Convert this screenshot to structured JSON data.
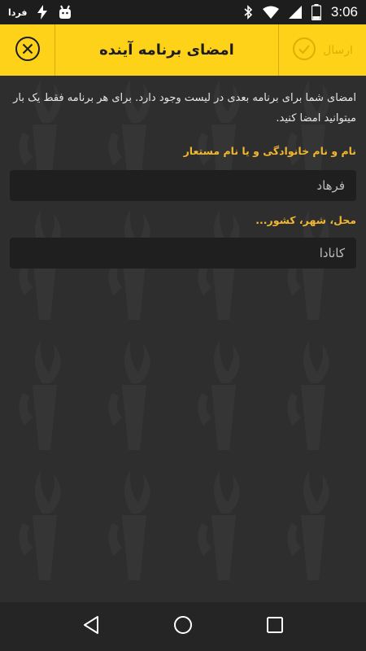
{
  "status_bar": {
    "time": "3:06",
    "app_logo_text": "فردا",
    "battery_level": "5"
  },
  "header": {
    "title": "امضای برنامه آینده",
    "send_label": "ارسال",
    "accent_color": "#ffd21a"
  },
  "form": {
    "intro": "امضای شما برای برنامه بعدی در لیست وجود دارد. برای هر برنامه فقط یک بار میتوانید امضا کنید.",
    "name_label": "نام و نام خانوادگی و یا نام مستعار",
    "name_value": "فرهاد",
    "place_label": "محل، شهر، کشور...",
    "place_value": "کانادا"
  },
  "icons": {
    "close": "close-circle-icon",
    "send": "check-circle-icon",
    "back": "back-triangle-icon",
    "home": "home-circle-icon",
    "recents": "recents-square-icon"
  }
}
